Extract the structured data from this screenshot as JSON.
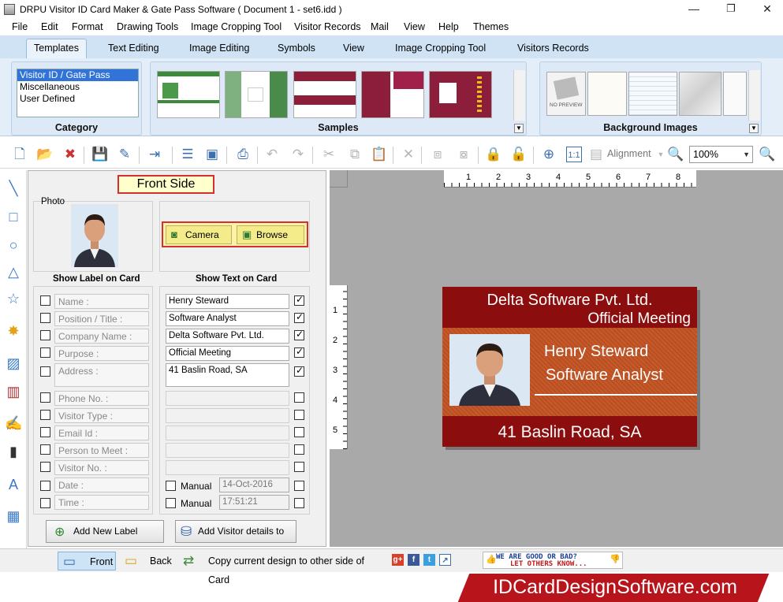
{
  "window": {
    "title": "DRPU Visitor ID Card Maker & Gate Pass Software ( Document 1 - set6.idd )",
    "minimize": "—",
    "restore": "❐",
    "close": "✕"
  },
  "menu": [
    "File",
    "Edit",
    "Format",
    "Drawing Tools",
    "Image Cropping Tool",
    "Visitor Records",
    "Mail",
    "View",
    "Help",
    "Themes"
  ],
  "ribbon_tabs": [
    "Templates",
    "Text Editing",
    "Image Editing",
    "Symbols",
    "View",
    "Image Cropping Tool",
    "Visitors Records"
  ],
  "ribbon": {
    "category": {
      "items": [
        "Visitor ID / Gate Pass",
        "Miscellaneous",
        "User Defined"
      ],
      "label": "Category"
    },
    "samples": {
      "label": "Samples"
    },
    "background": {
      "label": "Background Images",
      "no_preview": "NO PREVIEW"
    }
  },
  "toolbar": {
    "alignment": "Alignment",
    "zoom": "100%",
    "ratio": "1:1"
  },
  "panel": {
    "title": "Front Side",
    "photo_label": "Photo",
    "camera": "Camera",
    "browse": "Browse",
    "show_label_header": "Show Label on Card",
    "show_text_header": "Show Text on Card",
    "labels": [
      "Name :",
      "Position / Title :",
      "Company Name :",
      "Purpose :",
      "Address :",
      "Phone No. :",
      "Visitor Type :",
      "Email Id :",
      "Person to Meet :",
      "Visitor No. :",
      "Date :",
      "Time :"
    ],
    "values": [
      "Henry Steward",
      "Software Analyst",
      "Delta Software Pvt. Ltd.",
      "Official Meeting",
      "41 Baslin Road, SA"
    ],
    "manual": "Manual",
    "date": "14-Oct-2016",
    "time": "17:51:21",
    "add_label": "Add New Label",
    "add_db": "Add Visitor details to DB"
  },
  "card": {
    "company": "Delta Software Pvt. Ltd.",
    "purpose": "Official Meeting",
    "name": "Henry Steward",
    "title": "Software Analyst",
    "address": "41 Baslin Road, SA"
  },
  "ruler": {
    "h": [
      "1",
      "2",
      "3",
      "4",
      "5",
      "6",
      "7",
      "8"
    ],
    "v": [
      "1",
      "2",
      "3",
      "4",
      "5"
    ]
  },
  "bottom": {
    "front": "Front",
    "back": "Back",
    "copy": "Copy current design to other side of Card",
    "feedback_line1": "WE ARE GOOD OR BAD?",
    "feedback_line2": "LET OTHERS KNOW..."
  },
  "banner": "IDCardDesignSoftware.com"
}
